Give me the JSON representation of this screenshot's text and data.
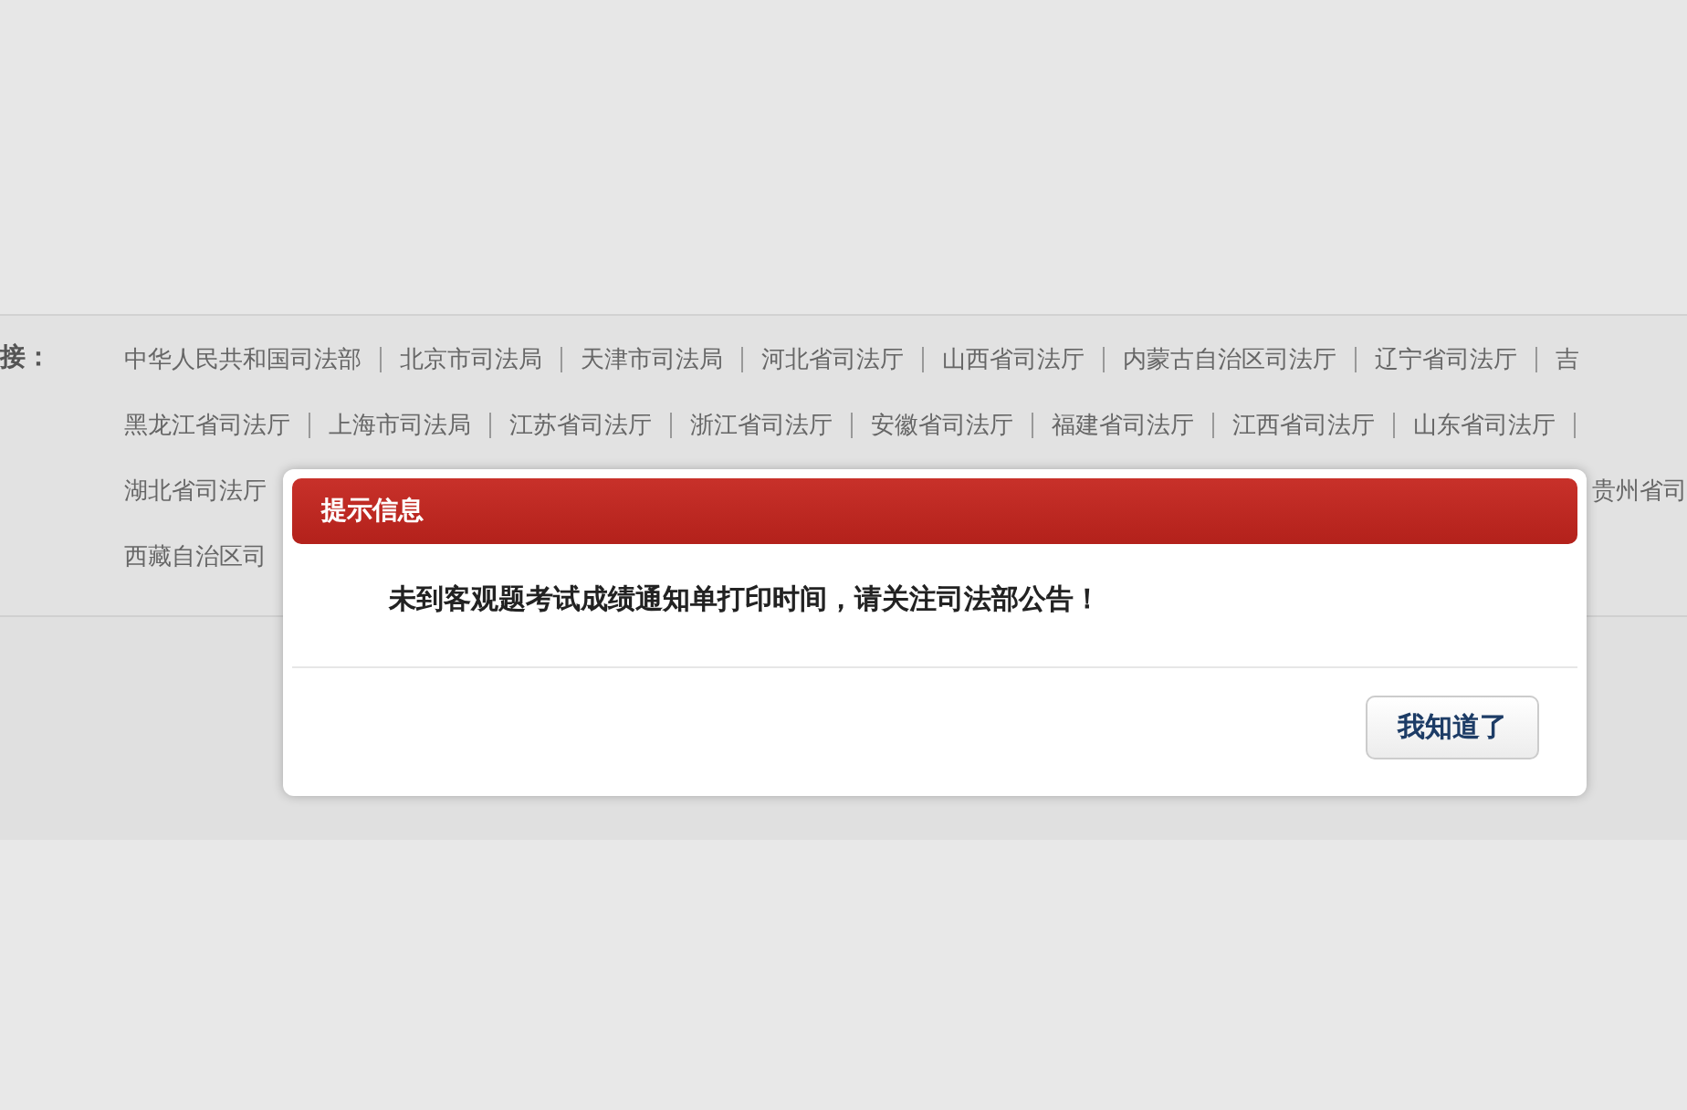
{
  "links_section": {
    "label": "接：",
    "rows": [
      {
        "items": [
          "中华人民共和国司法部",
          "北京市司法局",
          "天津市司法局",
          "河北省司法厅",
          "山西省司法厅",
          "内蒙古自治区司法厅",
          "辽宁省司法厅",
          "吉"
        ]
      },
      {
        "items": [
          "黑龙江省司法厅",
          "上海市司法局",
          "江苏省司法厅",
          "浙江省司法厅",
          "安徽省司法厅",
          "福建省司法厅",
          "江西省司法厅",
          "山东省司法厅"
        ],
        "trailing_divider": true
      },
      {
        "items": [
          "湖北省司法厅",
          "贵州省司"
        ]
      },
      {
        "items": [
          "西藏自治区司"
        ]
      }
    ]
  },
  "dialog": {
    "title": "提示信息",
    "message": "未到客观题考试成绩通知单打印时间，请关注司法部公告！",
    "button": "我知道了"
  }
}
